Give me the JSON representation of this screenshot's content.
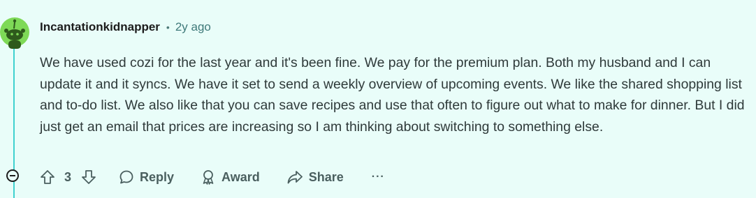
{
  "comment": {
    "username": "Incantationkidnapper",
    "separator": "•",
    "age": "2y ago",
    "body": "We have used cozi for the last year and it's been fine. We pay for the premium plan. Both my husband and I can update it and it syncs. We have it set to send a weekly overview of upcoming events. We like the shared shopping list and to-do list. We also like that you can save recipes and use that often to figure out what to make for dinner. But I did just get an email that prices are increasing so I am thinking about switching to something else.",
    "score": "3"
  },
  "actions": {
    "reply_label": "Reply",
    "award_label": "Award",
    "share_label": "Share",
    "more_label": "···"
  },
  "colors": {
    "background": "#e9fdf9",
    "thread_line": "#3fd1cf",
    "avatar_bg": "#7ed957"
  },
  "icons": [
    "avatar-snoo",
    "collapse-icon",
    "upvote-icon",
    "downvote-icon",
    "reply-icon",
    "award-icon",
    "share-icon",
    "more-icon"
  ]
}
